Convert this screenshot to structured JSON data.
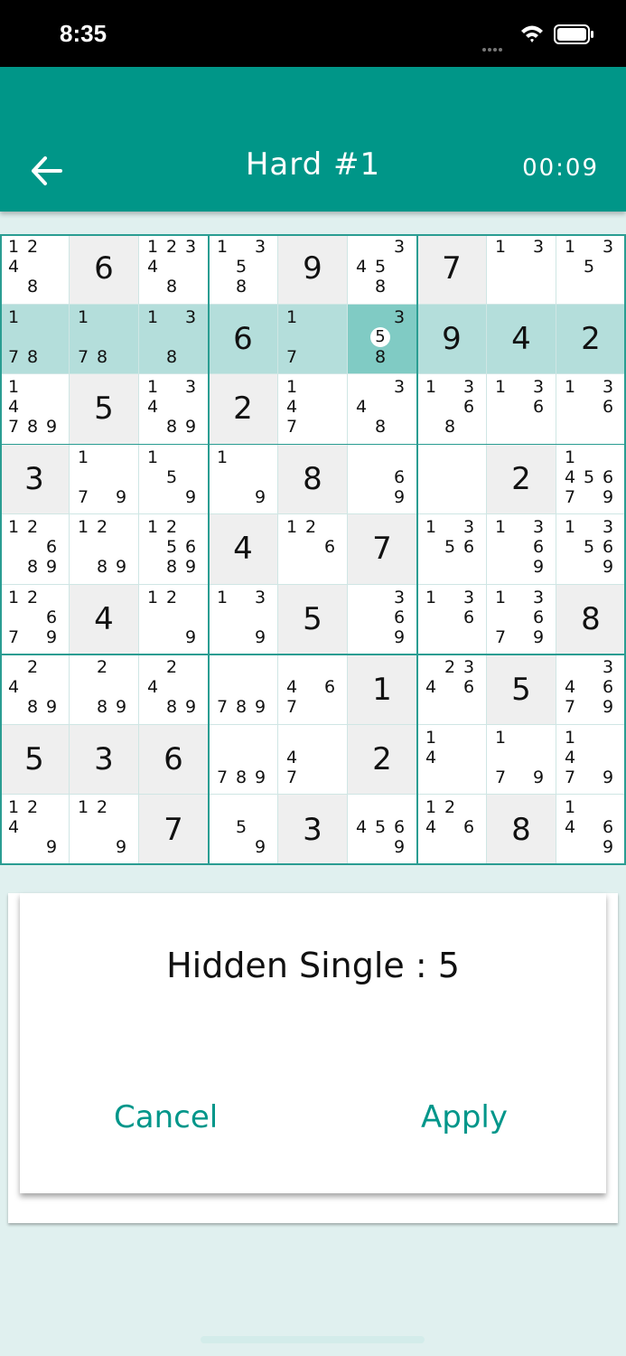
{
  "status_bar": {
    "time": "8:35"
  },
  "header": {
    "title": "Hard #1",
    "timer": "00:09"
  },
  "colors": {
    "accent": "#009688",
    "highlight": "#b4dedb",
    "selected": "#80cbc4",
    "given": "#efefef"
  },
  "board": {
    "selected_cell": [
      1,
      5
    ],
    "hint_digit": "5",
    "values": [
      [
        0,
        6,
        0,
        0,
        9,
        0,
        7,
        0,
        0
      ],
      [
        0,
        0,
        0,
        6,
        0,
        0,
        9,
        4,
        2
      ],
      [
        0,
        5,
        0,
        2,
        0,
        0,
        0,
        0,
        0
      ],
      [
        3,
        0,
        0,
        0,
        8,
        0,
        0,
        2,
        0
      ],
      [
        0,
        0,
        0,
        4,
        0,
        7,
        0,
        0,
        0
      ],
      [
        0,
        4,
        0,
        0,
        5,
        0,
        0,
        0,
        8
      ],
      [
        0,
        0,
        0,
        0,
        0,
        1,
        0,
        5,
        0
      ],
      [
        5,
        3,
        6,
        0,
        0,
        2,
        0,
        0,
        0
      ],
      [
        0,
        0,
        7,
        0,
        3,
        0,
        0,
        8,
        0
      ]
    ],
    "given": [
      [
        0,
        1,
        0,
        0,
        1,
        0,
        1,
        0,
        0
      ],
      [
        0,
        0,
        0,
        1,
        0,
        0,
        1,
        1,
        1
      ],
      [
        0,
        1,
        0,
        1,
        0,
        0,
        0,
        0,
        0
      ],
      [
        1,
        0,
        0,
        0,
        1,
        0,
        0,
        1,
        0
      ],
      [
        0,
        0,
        0,
        1,
        0,
        1,
        0,
        0,
        0
      ],
      [
        0,
        1,
        0,
        0,
        1,
        0,
        0,
        0,
        1
      ],
      [
        0,
        0,
        0,
        0,
        0,
        1,
        0,
        1,
        0
      ],
      [
        1,
        1,
        1,
        0,
        0,
        1,
        0,
        0,
        0
      ],
      [
        0,
        0,
        1,
        0,
        1,
        0,
        0,
        1,
        0
      ]
    ],
    "candidates": [
      [
        "1248",
        "",
        "12348",
        "1358",
        "",
        "3458",
        "",
        "13",
        "135"
      ],
      [
        "178",
        "178",
        "138",
        "",
        "17",
        "358",
        "",
        "",
        ""
      ],
      [
        "14789",
        "",
        "13489",
        "",
        "147",
        "348",
        "1368",
        "136",
        "136"
      ],
      [
        "",
        "179",
        "159",
        "19",
        "",
        "69",
        "",
        "",
        "145679"
      ],
      [
        "12689",
        "1289",
        "125689",
        "",
        "126",
        "",
        "1356",
        "1369",
        "13569"
      ],
      [
        "12679",
        "",
        "129",
        "139",
        "",
        "369",
        "136",
        "13679",
        ""
      ],
      [
        "2489",
        "289",
        "2489",
        "789",
        "467",
        "",
        "2346",
        "",
        "34679"
      ],
      [
        "",
        "",
        "",
        "789",
        "47",
        "",
        "14",
        "179",
        "1479"
      ],
      [
        "1249",
        "129",
        "",
        "59",
        "",
        "4569",
        "1246",
        "",
        "1469"
      ]
    ]
  },
  "dialog": {
    "message": "Hidden Single : 5",
    "cancel_label": "Cancel",
    "apply_label": "Apply"
  }
}
